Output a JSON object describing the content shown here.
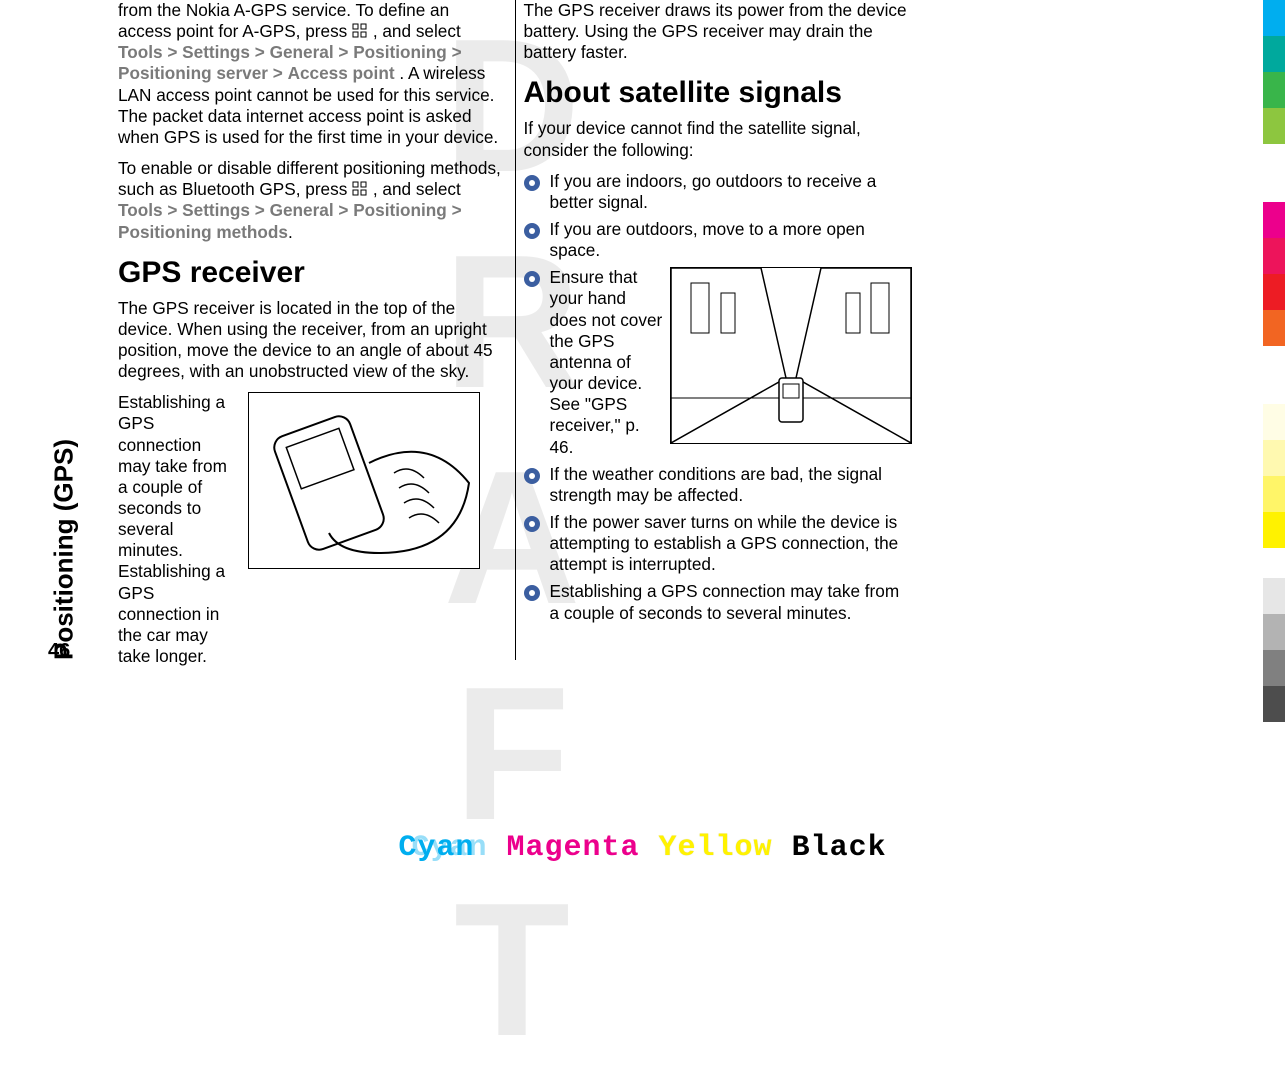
{
  "sidebar": {
    "chapter_title": "Positioning (GPS)",
    "page_number": "46"
  },
  "left_col": {
    "p1_a": "from the Nokia A-GPS service. To define an access point for A-GPS, press ",
    "p1_b": " , and select ",
    "p1_tools": "Tools",
    "p1_settings": "Settings",
    "p1_general": "General",
    "p1_positioning": "Positioning",
    "p1_pos_server": "Positioning server",
    "p1_access_point": "Access point",
    "p1_c": ". A wireless LAN access point cannot be used for this service. The packet data internet access point is asked when GPS is used for the first time in your device.",
    "p2_a": "To enable or disable different positioning methods, such as Bluetooth GPS, press ",
    "p2_b": " , and select ",
    "p2_tools": "Tools",
    "p2_settings": "Settings",
    "p2_general": "General",
    "p2_positioning": "Positioning",
    "p2_pos_methods": "Positioning methods",
    "h_gps_receiver": "GPS receiver",
    "p3": "The GPS receiver is located in the top of the device. When using the receiver, from an upright position, move the device to an angle of about 45 degrees, with an unobstructed view of the sky.",
    "p4": "Establishing a GPS connection may take from a couple of seconds to several minutes. Establishing a GPS connection in the car may take longer."
  },
  "right_col": {
    "p1": "The GPS receiver draws its power from the device battery. Using the GPS receiver may drain the battery faster.",
    "h_about": "About satellite signals",
    "p2": "If your device cannot find the satellite signal, consider the following:",
    "bullets": {
      "b1": "If you are indoors, go outdoors to receive a better signal.",
      "b2": "If you are outdoors, move to a more open space.",
      "b3": "Ensure that your hand does not cover the GPS antenna of your device. See \"GPS receiver,\" p. 46.",
      "b4": "If the weather conditions are bad, the signal strength may be affected.",
      "b5": "If the power saver turns on while the device is attempting to establish a GPS connection, the attempt is interrupted.",
      "b6": "Establishing a GPS connection may take from a couple of seconds to several minutes."
    }
  },
  "footer": {
    "cyan": "Cyan",
    "magenta": "Magenta",
    "yellow": "Yellow",
    "black": "Black"
  },
  "watermark": "DRAFT",
  "sep": ">"
}
